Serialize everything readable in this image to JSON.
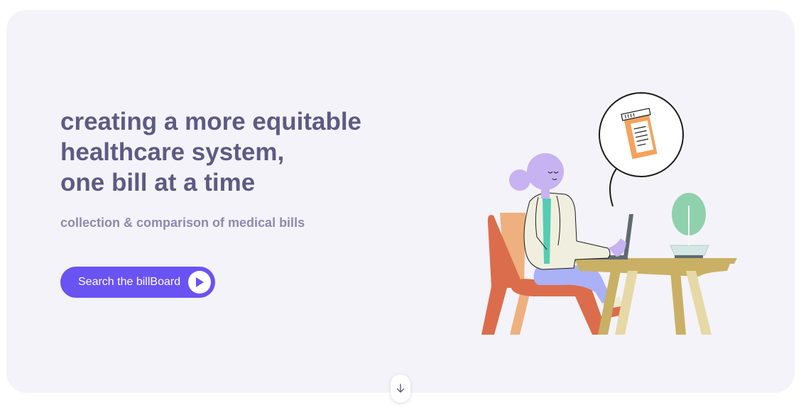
{
  "hero": {
    "headline_lines": [
      "creating a more equitable",
      "healthcare system,",
      "one bill at a time"
    ],
    "subtitle": "collection & comparison of medical bills",
    "cta": {
      "label": "Search the billBoard",
      "icon": "play-circle-icon"
    },
    "illustration": "doctor-at-laptop-illustration"
  },
  "scroll_down": {
    "icon": "arrow-down-icon"
  },
  "colors": {
    "page_background": "#ffffff",
    "hero_background": "#f4f3f9",
    "headline": "#5e5a84",
    "subtitle": "#8e89b0",
    "accent": "#6a53f3"
  }
}
